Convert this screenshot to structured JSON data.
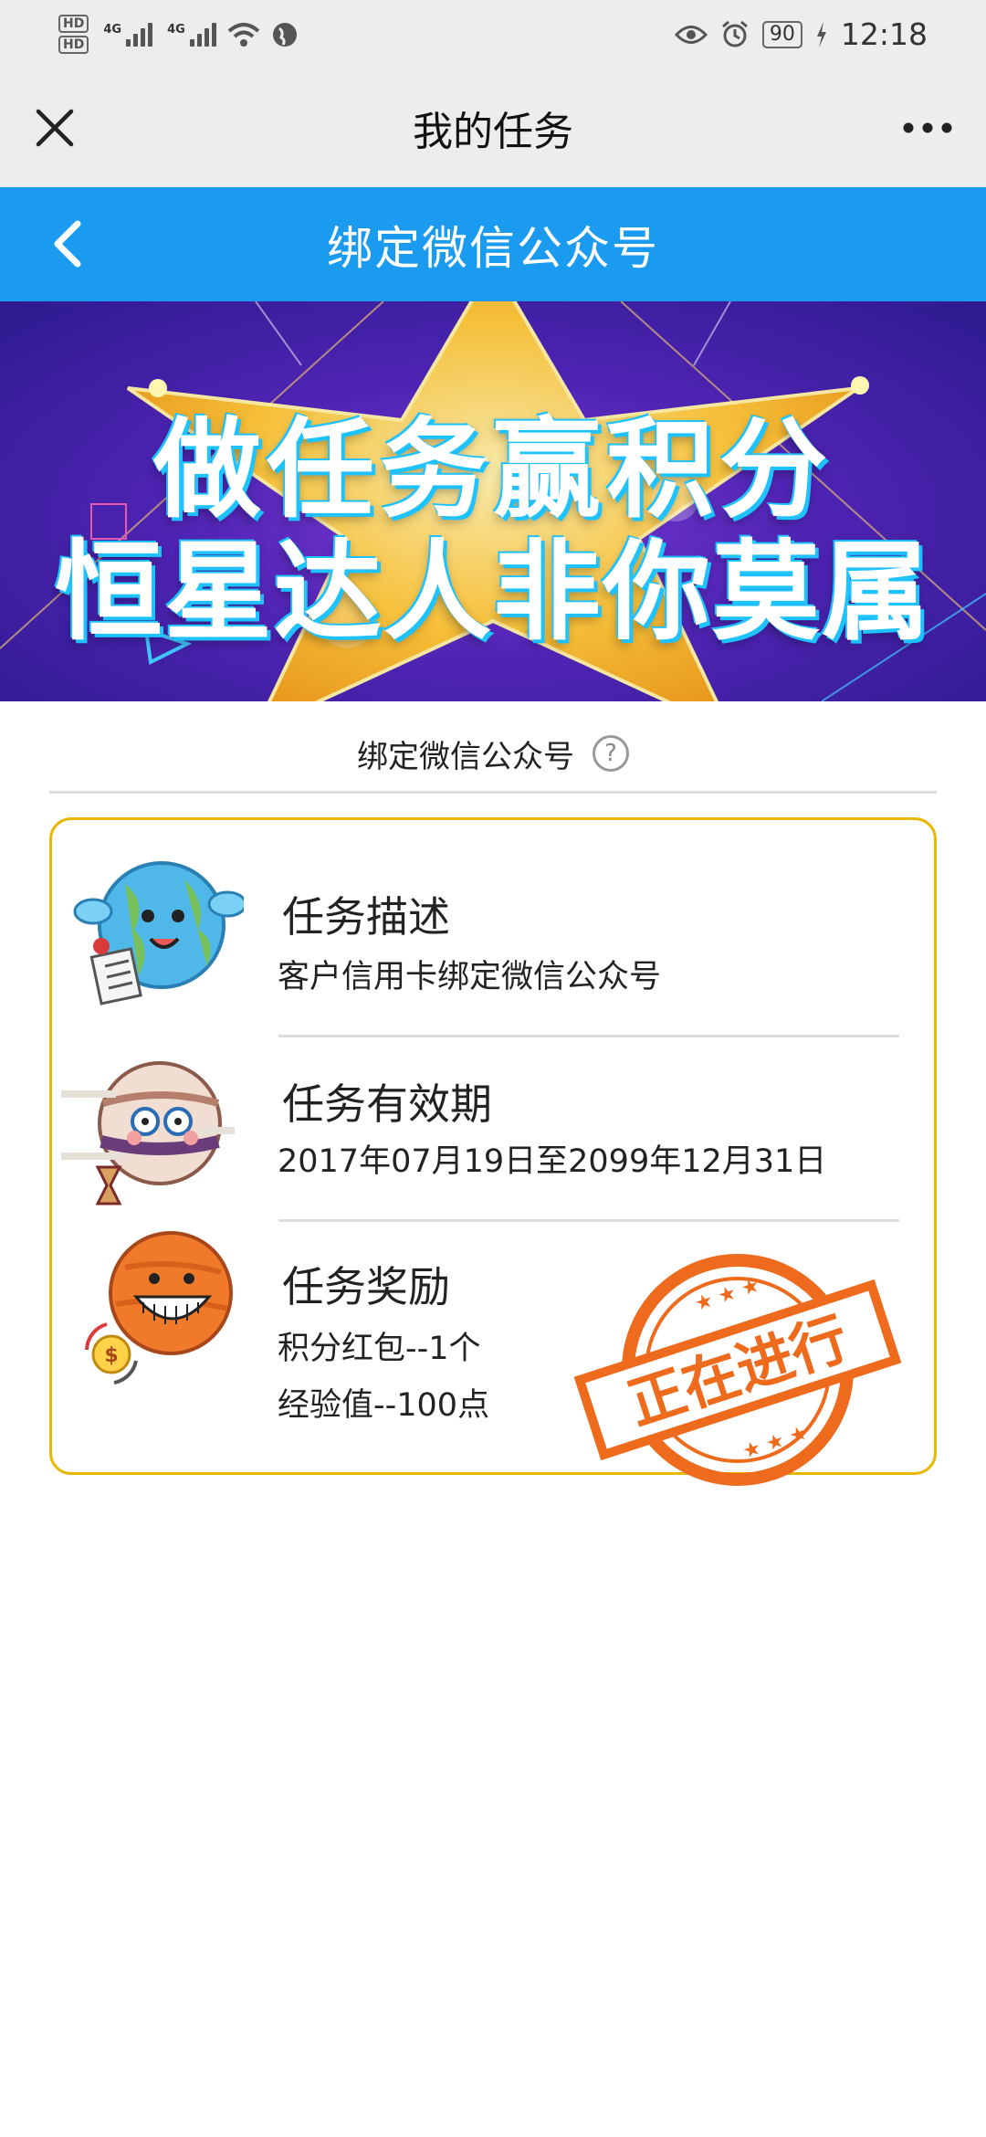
{
  "status_bar": {
    "hd1": "HD",
    "hd2": "HD",
    "net1": "4G",
    "net2": "4G",
    "battery": "90",
    "time": "12:18"
  },
  "header": {
    "title": "我的任务"
  },
  "title_bar": {
    "title": "绑定微信公众号"
  },
  "banner": {
    "line1": "做任务赢积分",
    "line2": "恒星达人非你莫属"
  },
  "section": {
    "label": "绑定微信公众号",
    "help_symbol": "?"
  },
  "task": {
    "description_heading": "任务描述",
    "description_value": "客户信用卡绑定微信公众号",
    "validity_heading": "任务有效期",
    "validity_value": "2017年07月19日至2099年12月31日",
    "reward_heading": "任务奖励",
    "reward_items": [
      "积分红包--1个",
      "经验值--100点"
    ],
    "status_stamp": "正在进行"
  },
  "colors": {
    "title_bar": "#1a9bf0",
    "card_border": "#e8b700",
    "stamp": "#ee6b1e"
  }
}
